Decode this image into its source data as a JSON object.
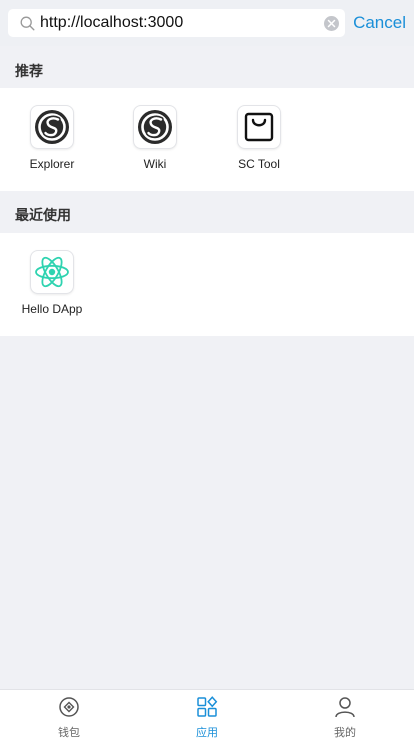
{
  "search": {
    "value": "http://localhost:3000",
    "cancel_label": "Cancel"
  },
  "recommended": {
    "title": "推荐",
    "apps": [
      {
        "label": "Explorer",
        "icon": "sc-logo-icon"
      },
      {
        "label": "Wiki",
        "icon": "sc-logo-icon"
      },
      {
        "label": "SC Tool",
        "icon": "shopping-bag-icon"
      }
    ]
  },
  "recent": {
    "title": "最近使用",
    "apps": [
      {
        "label": "Hello DApp",
        "icon": "react-atom-icon"
      }
    ]
  },
  "tabbar": {
    "tabs": [
      {
        "label": "钱包",
        "icon": "wallet-icon"
      },
      {
        "label": "应用",
        "icon": "apps-icon"
      },
      {
        "label": "我的",
        "icon": "profile-icon"
      }
    ],
    "active_index": 1,
    "active_color": "#1a8fd8"
  },
  "colors": {
    "accent": "#1a8fd8",
    "react": "#2ed3b0"
  }
}
